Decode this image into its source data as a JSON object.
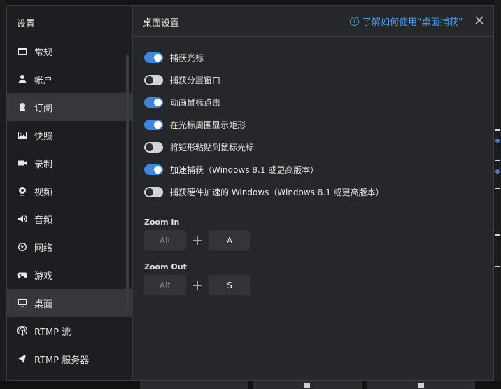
{
  "sidebar": {
    "title": "设置",
    "items": [
      {
        "label": "常规",
        "icon": "window-icon",
        "active": false
      },
      {
        "label": "帐户",
        "icon": "user-icon",
        "active": false
      },
      {
        "label": "订阅",
        "icon": "ribbon-icon",
        "active": true
      },
      {
        "label": "快照",
        "icon": "image-icon",
        "active": false
      },
      {
        "label": "录制",
        "icon": "camera-icon",
        "active": false
      },
      {
        "label": "视频",
        "icon": "webcam-icon",
        "active": false
      },
      {
        "label": "音频",
        "icon": "speaker-icon",
        "active": false
      },
      {
        "label": "网络",
        "icon": "network-icon",
        "active": false
      },
      {
        "label": "游戏",
        "icon": "gamepad-icon",
        "active": false
      },
      {
        "label": "桌面",
        "icon": "monitor-icon",
        "active": true
      },
      {
        "label": "RTMP 流",
        "icon": "broadcast-icon",
        "active": false
      },
      {
        "label": "RTMP 服务器",
        "icon": "server-icon",
        "active": false
      }
    ]
  },
  "header": {
    "title": "桌面设置",
    "help_text": "了解如何使用“桌面捕获”",
    "help_icon": "?"
  },
  "toggles": [
    {
      "label": "捕获光标",
      "on": true
    },
    {
      "label": "捕获分层窗口",
      "on": false
    },
    {
      "label": "动画鼠标点击",
      "on": true
    },
    {
      "label": "在光标周围显示矩形",
      "on": true
    },
    {
      "label": "将矩形粘贴到鼠标光标",
      "on": false
    },
    {
      "label": "加速捕获（Windows 8.1 或更高版本）",
      "on": true
    },
    {
      "label": "捕获硬件加速的 Windows（Windows 8.1 或更高版本）",
      "on": false
    }
  ],
  "zoom_in": {
    "label": "Zoom In",
    "modifier": "Alt",
    "key": "A"
  },
  "zoom_out": {
    "label": "Zoom Out",
    "modifier": "Alt",
    "key": "S"
  },
  "colors": {
    "accent": "#3d87db",
    "link": "#4a9eed",
    "sidebar_bg": "#1d1e21",
    "panel_bg": "#25272a"
  }
}
